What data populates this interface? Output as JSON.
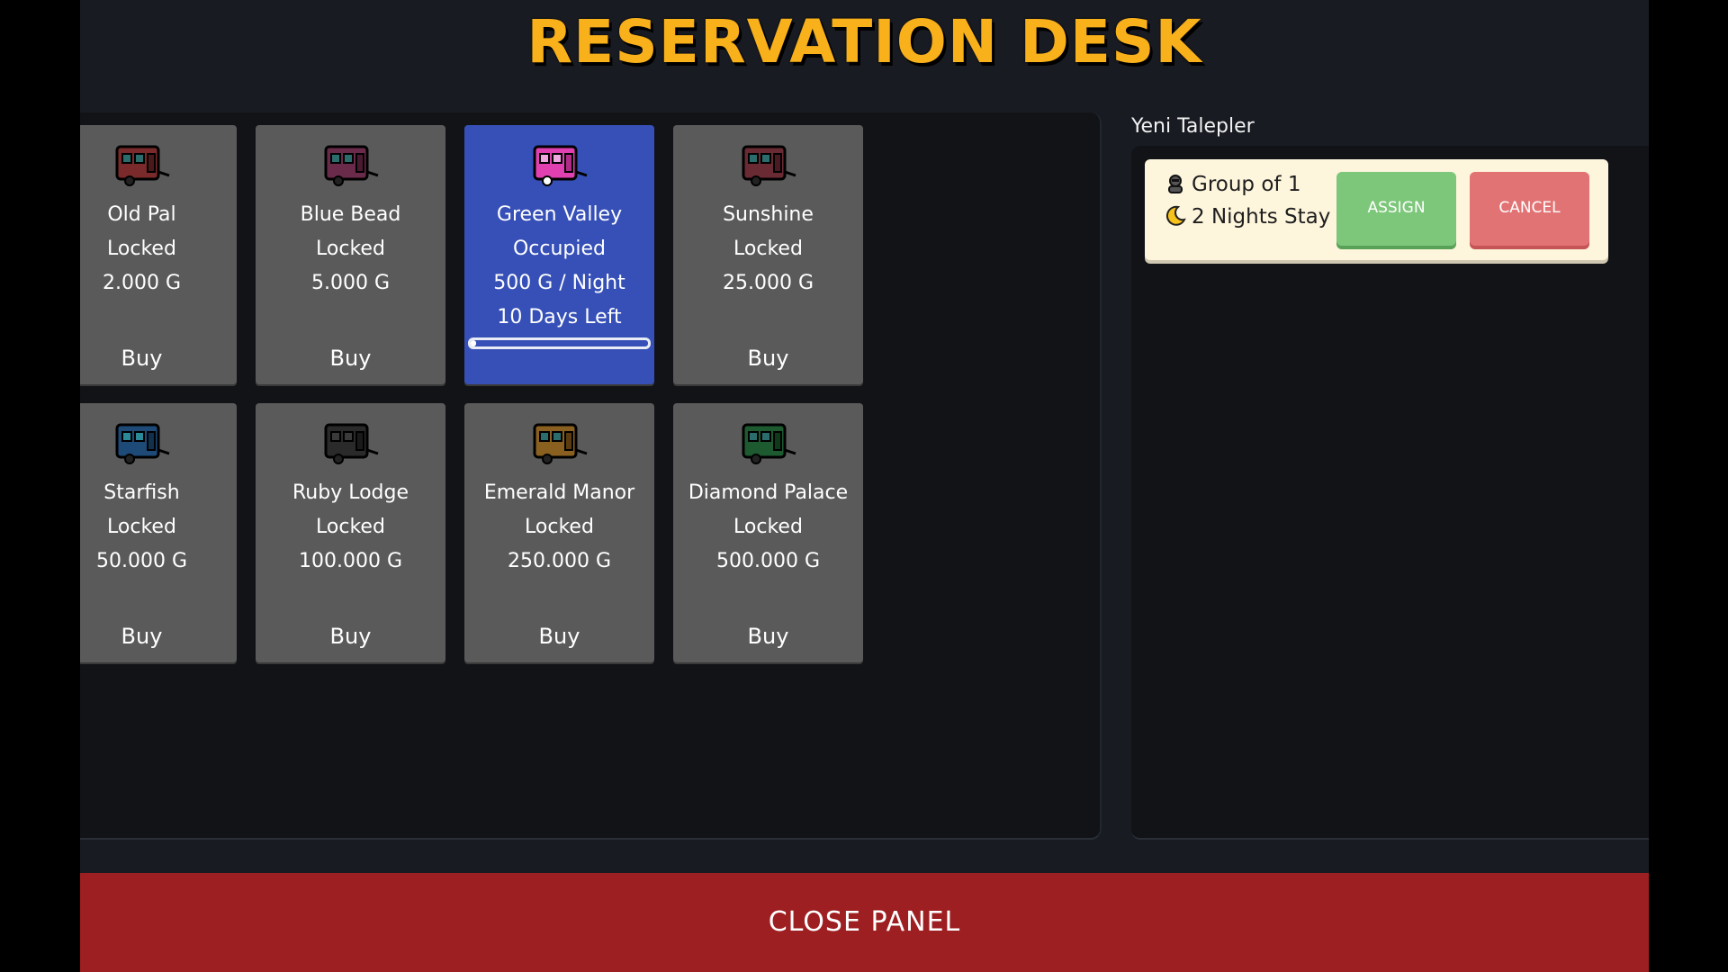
{
  "title": "RESERVATION DESK",
  "colors": {
    "title": "#f8b01b",
    "card_bg": "#5a5a5a",
    "card_active_bg": "#3650b7",
    "assign": "#7dc77a",
    "cancel": "#e27374",
    "close_bar": "#9e1f22"
  },
  "caravans": [
    {
      "name": "Old Pal",
      "status": "Locked",
      "price": "2.000 G",
      "action": "Buy",
      "color": "#7a2a2a",
      "icon": "red-caravan-icon"
    },
    {
      "name": "Blue Bead",
      "status": "Locked",
      "price": "5.000 G",
      "action": "Buy",
      "color": "#6a2a4a",
      "icon": "magenta-caravan-icon"
    },
    {
      "name": "Green Valley",
      "status": "Occupied",
      "price": "500 G / Night",
      "days_left": "10 Days Left",
      "progress": 0.03,
      "color": "#e040b0",
      "icon": "pink-caravan-icon"
    },
    {
      "name": "Sunshine",
      "status": "Locked",
      "price": "25.000 G",
      "action": "Buy",
      "color": "#6a2a34",
      "icon": "red-caravan-icon"
    },
    {
      "name": "Starfish",
      "status": "Locked",
      "price": "50.000 G",
      "action": "Buy",
      "color": "#1e4a78",
      "icon": "blue-caravan-icon"
    },
    {
      "name": "Ruby Lodge",
      "status": "Locked",
      "price": "100.000 G",
      "action": "Buy",
      "color": "#2a2a2a",
      "icon": "black-caravan-icon"
    },
    {
      "name": "Emerald Manor",
      "status": "Locked",
      "price": "250.000 G",
      "action": "Buy",
      "color": "#8a6020",
      "icon": "orange-caravan-icon"
    },
    {
      "name": "Diamond Palace",
      "status": "Locked",
      "price": "500.000 G",
      "action": "Buy",
      "color": "#1e5a30",
      "icon": "green-caravan-icon"
    }
  ],
  "requests": {
    "title": "Yeni Talepler",
    "items": [
      {
        "group": "Group of 1",
        "stay": "2 Nights Stay",
        "assign_label": "ASSIGN",
        "cancel_label": "CANCEL"
      }
    ]
  },
  "close_label": "CLOSE PANEL"
}
